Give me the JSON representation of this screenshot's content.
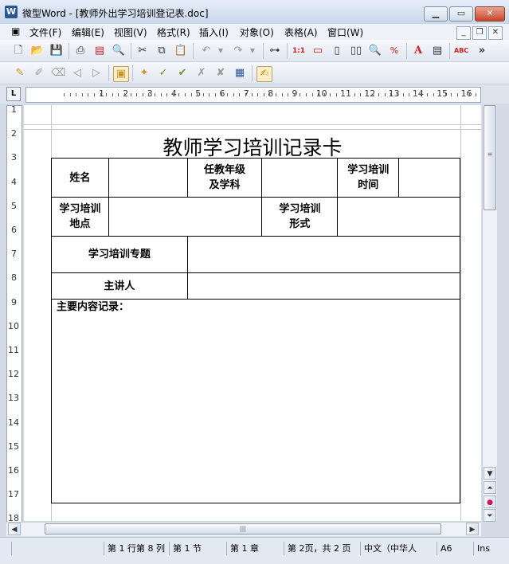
{
  "window": {
    "title": "微型Word - [教师外出学习培训登记表.doc]",
    "app_icon_letter": "W"
  },
  "menu": [
    "文件(F)",
    "编辑(E)",
    "视图(V)",
    "格式(R)",
    "插入(I)",
    "对象(O)",
    "表格(A)",
    "窗口(W)"
  ],
  "ruler": {
    "corner": "L",
    "h_numbers": [
      "1",
      "2",
      "3",
      "4",
      "5",
      "6",
      "7",
      "8",
      "9",
      "10",
      "11",
      "12",
      "13",
      "14",
      "15",
      "16"
    ],
    "v_numbers": [
      "1",
      "2",
      "3",
      "4",
      "5",
      "6",
      "7",
      "8",
      "9",
      "10",
      "11",
      "12",
      "13",
      "14",
      "15",
      "16",
      "17",
      "18"
    ]
  },
  "document": {
    "title": "教师学习培训记录卡",
    "table": {
      "name_label": "姓名",
      "subject_label_1": "任教年级",
      "subject_label_2": "及学科",
      "time_label_1": "学习培训",
      "time_label_2": "时间",
      "place_label_1": "学习培训",
      "place_label_2": "地点",
      "form_label_1": "学习培训",
      "form_label_2": "形式",
      "topic_label": "学习培训专题",
      "speaker_label": "主讲人",
      "content_label": "主要内容记录："
    }
  },
  "statusbar": {
    "cell1": "",
    "position": "第 1 行第 8 列",
    "section": "第 1 节",
    "chapter": "第 1 章",
    "page": "第 2页，共 2 页",
    "language": "中文（中华人",
    "field": "A6",
    "mode": "Ins"
  }
}
